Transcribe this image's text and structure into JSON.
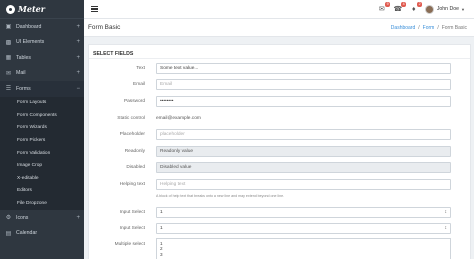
{
  "brand": {
    "name": "Meter"
  },
  "sidebar": {
    "items": [
      {
        "label": "Dashboard",
        "icon": "dashboard-icon",
        "toggle": "+"
      },
      {
        "label": "UI Elements",
        "icon": "grid-icon",
        "toggle": "+"
      },
      {
        "label": "Tables",
        "icon": "table-icon",
        "toggle": "+"
      },
      {
        "label": "Mail",
        "icon": "mail-icon",
        "toggle": "+"
      },
      {
        "label": "Forms",
        "icon": "forms-icon",
        "toggle": "−"
      }
    ],
    "subitems": [
      "Form Layouts",
      "Form Components",
      "Form Wizards",
      "Form Pickers",
      "Form Validation",
      "Image Crop",
      "X-editable",
      "Editors",
      "File Dropzone"
    ],
    "after": [
      {
        "label": "Icons",
        "icon": "icons-icon",
        "toggle": "+"
      },
      {
        "label": "Calendar",
        "icon": "calendar-icon",
        "toggle": ""
      }
    ]
  },
  "topbar": {
    "badges": [
      "9",
      "4",
      "2"
    ],
    "user": "John Doe"
  },
  "page": {
    "title": "Form Basic",
    "breadcrumb": [
      "Dashboard",
      "/",
      "Form",
      "/",
      "Form Basic"
    ]
  },
  "panel": {
    "title": "SELECT FIELDS",
    "fields": {
      "text": {
        "label": "Text",
        "value": "Some text value..."
      },
      "email": {
        "label": "Email",
        "placeholder": "Email"
      },
      "password": {
        "label": "Password",
        "value": "••••••••"
      },
      "static": {
        "label": "Static control",
        "value": "email@example.com"
      },
      "placeholder": {
        "label": "Placeholder",
        "placeholder": "placeholder"
      },
      "readonly": {
        "label": "Readonly",
        "value": "Readonly value"
      },
      "disabled": {
        "label": "Disabled",
        "value": "Disabled value"
      },
      "helping": {
        "label": "Helping text",
        "placeholder": "Helping text",
        "help": "A block of help text that breaks onto a new line and may extend beyond one line."
      },
      "select1": {
        "label": "Input Select",
        "value": "1"
      },
      "select2": {
        "label": "Input Select",
        "value": "1"
      },
      "multi": {
        "label": "Multiple select",
        "options": [
          "1",
          "2",
          "3"
        ]
      }
    }
  }
}
